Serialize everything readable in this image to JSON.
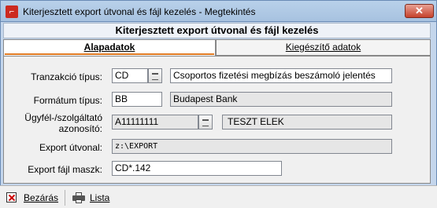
{
  "window": {
    "title": "Kiterjesztett export útvonal és fájl kezelés - Megtekintés",
    "close_label": "✕"
  },
  "header": {
    "title": "Kiterjesztett export útvonal és fájl kezelés"
  },
  "tabs": [
    {
      "label": "Alapadatok",
      "active": true
    },
    {
      "label": "Kiegészítő adatok",
      "active": false
    }
  ],
  "form": {
    "tranzakcio_tipus": {
      "label": "Tranzakció típus:",
      "code": "CD",
      "description": "Csoportos fizetési megbízás beszámoló jelentés"
    },
    "formatum_tipus": {
      "label": "Formátum típus:",
      "code": "BB",
      "description": "Budapest Bank"
    },
    "ugyfel": {
      "label_line1": "Ügyfél-/szolgáltató",
      "label_line2": "azonosító:",
      "code": "A11111111",
      "description": "TESZT ELEK"
    },
    "export_utvonal": {
      "label": "Export útvonal:",
      "value": "z:\\EXPORT"
    },
    "export_fajl_maszk": {
      "label": "Export fájl maszk:",
      "value": "CD*.142"
    }
  },
  "statusbar": {
    "close_label": "Bezárás",
    "list_label": "Lista"
  },
  "colors": {
    "titlebar": "#b9d1ea",
    "close_button": "#c6422c",
    "tab_accent": "#e07a22"
  },
  "icons": {
    "app": "app-icon",
    "close": "close-icon",
    "lookup": "list-lookup-icon",
    "bezaras": "x-icon",
    "lista": "printer-icon"
  }
}
